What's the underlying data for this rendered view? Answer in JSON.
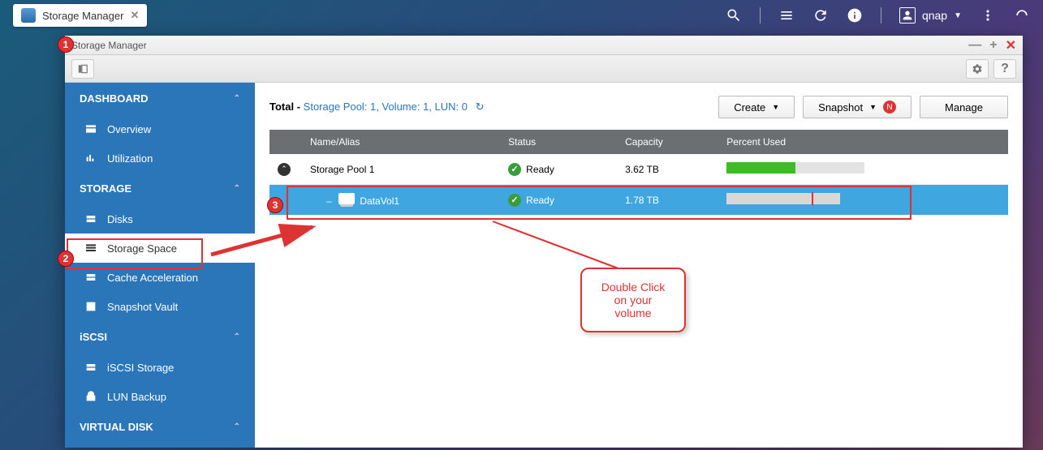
{
  "sysbar": {
    "tab_title": "Storage Manager",
    "username": "qnap"
  },
  "window": {
    "title": "Storage Manager"
  },
  "sidebar": {
    "dashboard_label": "DASHBOARD",
    "overview_label": "Overview",
    "utilization_label": "Utilization",
    "storage_label": "STORAGE",
    "disks_label": "Disks",
    "storage_space_label": "Storage Space",
    "cache_accel_label": "Cache Acceleration",
    "snapshot_vault_label": "Snapshot Vault",
    "iscsi_label": "iSCSI",
    "iscsi_storage_label": "iSCSI Storage",
    "lun_backup_label": "LUN Backup",
    "virtual_disk_label": "VIRTUAL DISK"
  },
  "main": {
    "total_label": "Total -",
    "total_values": "Storage Pool: 1, Volume: 1, LUN: 0",
    "create_btn": "Create",
    "snapshot_btn": "Snapshot",
    "snapshot_badge": "N",
    "manage_btn": "Manage",
    "col_name": "Name/Alias",
    "col_status": "Status",
    "col_capacity": "Capacity",
    "col_percent": "Percent Used",
    "pool_name": "Storage Pool 1",
    "pool_status": "Ready",
    "pool_capacity": "3.62 TB",
    "pool_percent_fill": 50,
    "vol_name": "DataVol1",
    "vol_status": "Ready",
    "vol_capacity": "1.78 TB",
    "vol_tick_pos": 75
  },
  "annotations": {
    "marker1": "1",
    "marker2": "2",
    "marker3": "3",
    "callout_text": "Double Click on your volume"
  }
}
